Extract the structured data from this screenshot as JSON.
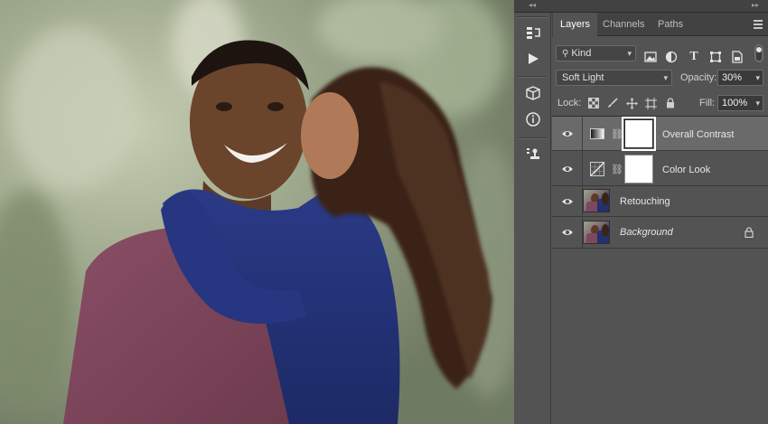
{
  "canvas": {
    "description_alt": ""
  },
  "panel": {
    "tabs": [
      {
        "label": "Layers",
        "active": true
      },
      {
        "label": "Channels",
        "active": false
      },
      {
        "label": "Paths",
        "active": false
      }
    ],
    "filter": {
      "label": "Kind"
    },
    "blend_mode": {
      "value": "Soft Light"
    },
    "opacity": {
      "label": "Opacity:",
      "value": "30%"
    },
    "lock": {
      "label": "Lock:"
    },
    "fill": {
      "label": "Fill:",
      "value": "100%"
    },
    "layers": [
      {
        "name": "Overall Contrast",
        "kind": "gradient-map-adjustment",
        "selected": true,
        "visible": true,
        "italic": false
      },
      {
        "name": "Color Look",
        "kind": "curves-adjustment",
        "selected": false,
        "visible": true,
        "italic": false
      },
      {
        "name": "Retouching",
        "kind": "pixel-layer",
        "selected": false,
        "visible": true,
        "italic": false
      },
      {
        "name": "Background",
        "kind": "pixel-layer",
        "selected": false,
        "visible": true,
        "italic": true,
        "locked": true
      }
    ]
  },
  "colors": {
    "panel_bg": "#535353",
    "tab_bar_bg": "#424242",
    "selected_layer_bg": "#6a6a6a",
    "text": "#e6e6e6"
  }
}
